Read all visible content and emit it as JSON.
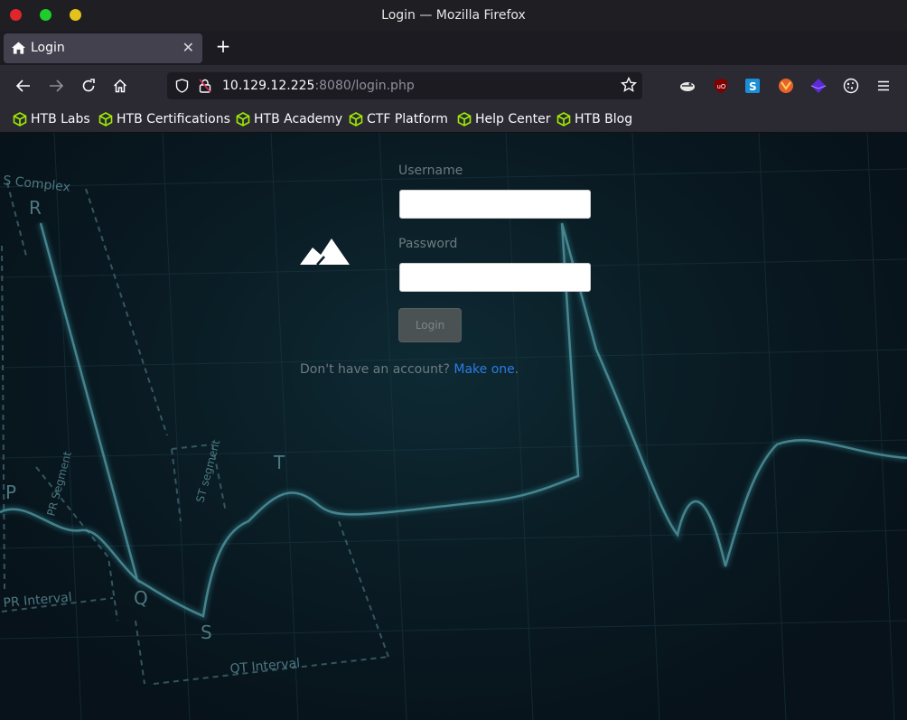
{
  "window": {
    "title": "Login — Mozilla Firefox"
  },
  "tab": {
    "label": "Login",
    "close": "✕"
  },
  "newtab": "+",
  "url": {
    "host": "10.129.12.225",
    "rest": ":8080/login.php"
  },
  "bookmarks": [
    {
      "label": "HTB Labs"
    },
    {
      "label": "HTB Certifications"
    },
    {
      "label": "HTB Academy"
    },
    {
      "label": "CTF Platform"
    },
    {
      "label": "Help Center"
    },
    {
      "label": "HTB Blog"
    }
  ],
  "login": {
    "username_label": "Username",
    "password_label": "Password",
    "button_label": "Login",
    "signup_text": "Don't have an account?",
    "signup_link": "Make one",
    "signup_suffix": "."
  },
  "background_labels": {
    "complex": "S Complex",
    "r": "R",
    "p": "P",
    "q": "Q",
    "s": "S",
    "t": "T",
    "pr_segment": "PR Segment",
    "st_segment": "ST segment",
    "pr_interval": "PR Interval",
    "qt_interval": "QT Interval"
  },
  "colors": {
    "accent": "#9fef00",
    "link": "#2b7ce3",
    "background": "#0a1c24"
  }
}
